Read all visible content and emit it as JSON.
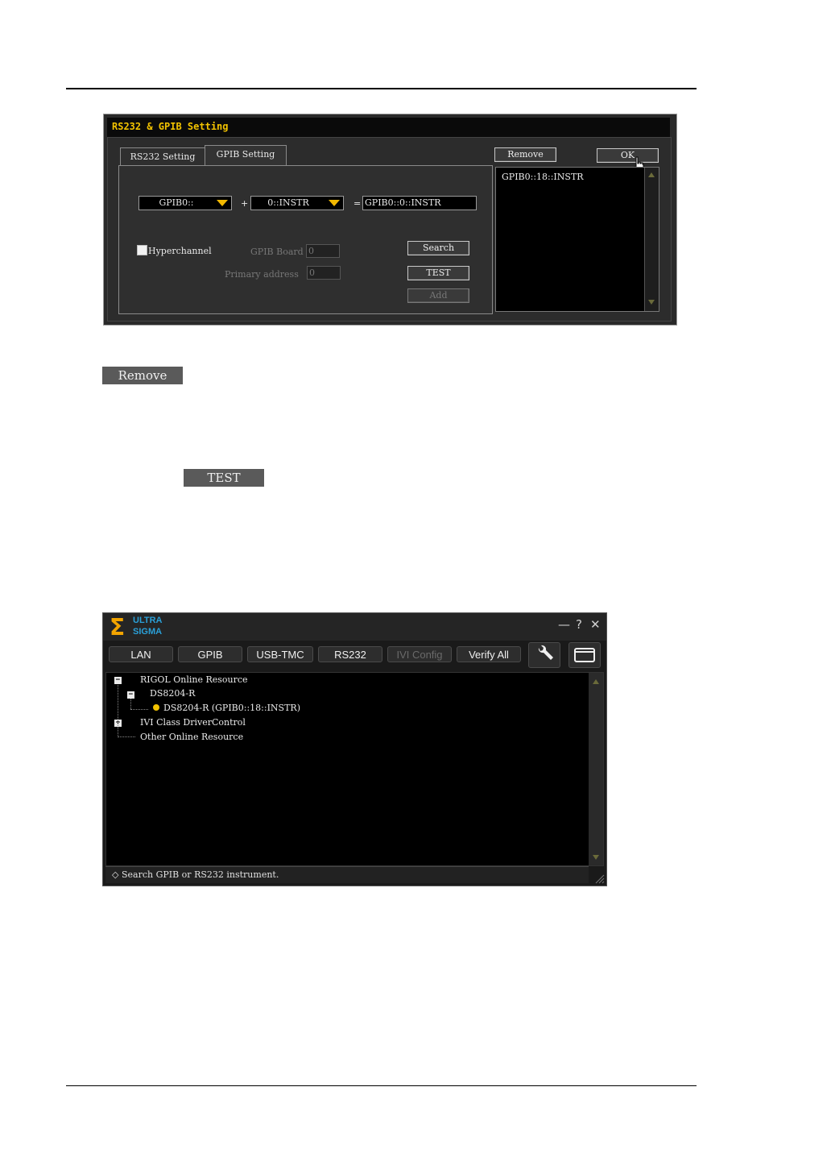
{
  "dialog1": {
    "title": "RS232 & GPIB Setting",
    "tabs": [
      "RS232 Setting",
      "GPIB Setting"
    ],
    "board_select": "GPIB0::",
    "address_select": "0::INSTR",
    "plus": "+",
    "equals": "=",
    "result": "GPIB0::0::INSTR",
    "hyperchannel_label": "Hyperchannel",
    "gpib_board_label": "GPIB Board",
    "gpib_board_value": "0",
    "primary_address_label": "Primary address",
    "primary_address_value": "0",
    "search_label": "Search",
    "test_label": "TEST",
    "add_label": "Add",
    "remove_label": "Remove",
    "ok_label": "OK",
    "resource_list": [
      "GPIB0::18::INSTR"
    ]
  },
  "inline_buttons": {
    "remove": "Remove",
    "test": "TEST"
  },
  "dialog2": {
    "logo_line1": "ULTRA",
    "logo_line2": "SIGMA",
    "controls": [
      "—",
      "?",
      "✕"
    ],
    "toolbar": [
      "LAN",
      "GPIB",
      "USB-TMC",
      "RS232",
      "IVI Config",
      "Verify All"
    ],
    "tree": {
      "root": "RIGOL Online Resource",
      "device": "DS8204-R",
      "instrument": "DS8204-R (GPIB0::18::INSTR)",
      "ivi": "IVI Class DriverControl",
      "other": "Other Online Resource"
    },
    "status": "Search GPIB or RS232 instrument."
  }
}
